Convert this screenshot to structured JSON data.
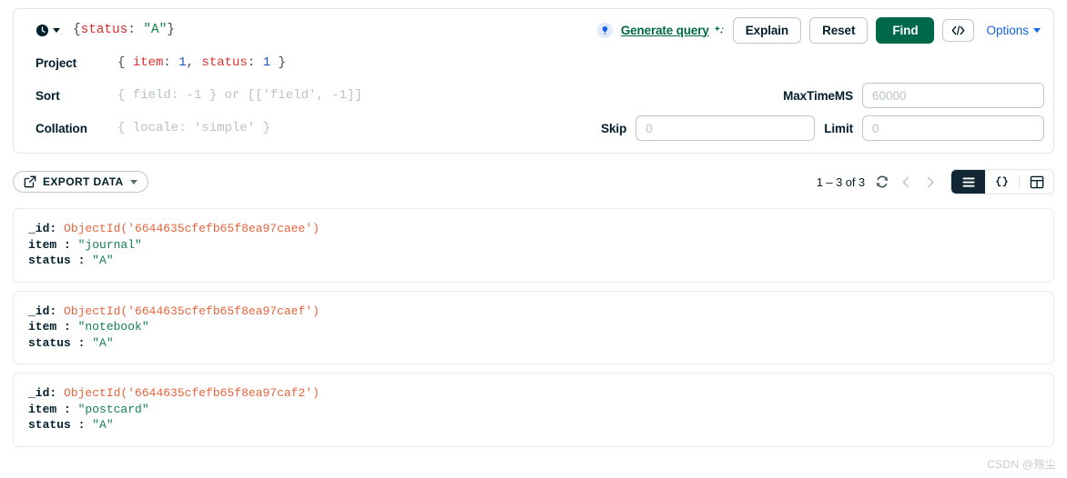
{
  "query_bar": {
    "history_icon": "clock-icon",
    "filter": {
      "open_brace": "{",
      "key": "status",
      "colon": ": ",
      "value": "\"A\"",
      "close_brace": "}"
    },
    "generate_query": {
      "bulb_icon": "lightbulb-icon",
      "label": "Generate query",
      "sparkle_icon": "sparkle-icon"
    },
    "buttons": {
      "explain": "Explain",
      "reset": "Reset",
      "find": "Find",
      "code_icon": "code-brackets-icon"
    },
    "options": {
      "label": "Options",
      "caret_icon": "chevron-down-icon"
    }
  },
  "options_rows": {
    "project": {
      "label": "Project",
      "brace_open": "{ ",
      "key1": "item",
      "sep1": ": ",
      "num1": "1",
      "comma": ", ",
      "key2": "status",
      "sep2": ": ",
      "num2": "1",
      "brace_close": " }"
    },
    "sort": {
      "label": "Sort",
      "placeholder": "{ field: -1 } or [['field', -1]]"
    },
    "collation": {
      "label": "Collation",
      "placeholder": "{ locale: 'simple' }"
    },
    "maxtimems": {
      "label": "MaxTimeMS",
      "value": "",
      "placeholder": "60000"
    },
    "skip": {
      "label": "Skip",
      "value": "",
      "placeholder": "0"
    },
    "limit": {
      "label": "Limit",
      "value": "",
      "placeholder": "0"
    }
  },
  "results_toolbar": {
    "export": {
      "icon": "export-icon",
      "label": "EXPORT DATA",
      "caret_icon": "chevron-down-icon"
    },
    "count": "1 – 3 of 3",
    "refresh_icon": "refresh-icon",
    "prev_icon": "chevron-left-icon",
    "next_icon": "chevron-right-icon",
    "views": [
      {
        "name": "list-view",
        "icon": "list-icon",
        "active": true
      },
      {
        "name": "json-view",
        "icon": "braces-icon",
        "active": false
      },
      {
        "name": "table-view",
        "icon": "table-icon",
        "active": false
      }
    ]
  },
  "documents": [
    {
      "id_key": "_id:",
      "id_value": "ObjectId('6644635cfefb65f8ea97caee')",
      "item_key": "item :",
      "item_value": "\"journal\"",
      "status_key": "status :",
      "status_value": "\"A\""
    },
    {
      "id_key": "_id:",
      "id_value": "ObjectId('6644635cfefb65f8ea97caef')",
      "item_key": "item :",
      "item_value": "\"notebook\"",
      "status_key": "status :",
      "status_value": "\"A\""
    },
    {
      "id_key": "_id:",
      "id_value": "ObjectId('6644635cfefb65f8ea97caf2')",
      "item_key": "item :",
      "item_value": "\"postcard\"",
      "status_key": "status :",
      "status_value": "\"A\""
    }
  ],
  "watermark": "CSDN @殇尘",
  "colors": {
    "find_green": "#00684a",
    "link_blue": "#1565e8",
    "string_green": "#12824d",
    "key_red": "#db3030",
    "objectid_orange": "#e8643c",
    "number_blue": "#1750c4",
    "active_view_dark": "#112733"
  }
}
